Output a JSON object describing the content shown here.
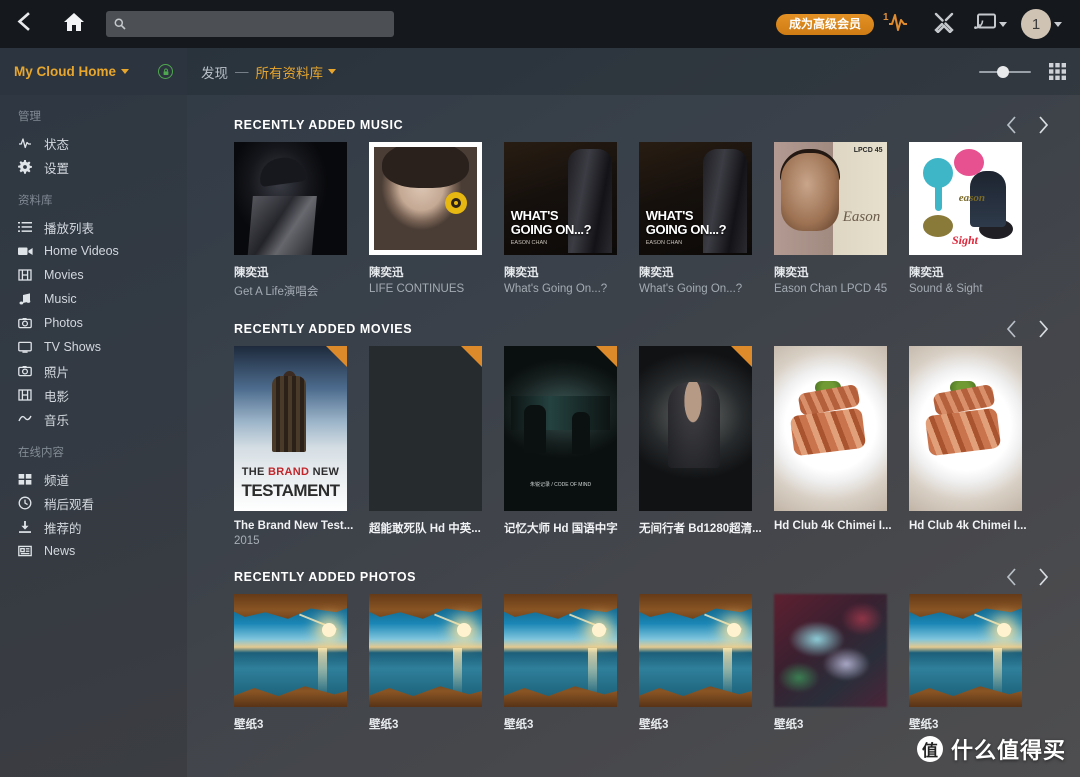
{
  "topbar": {
    "back_icon": "chevron-left-icon",
    "home_icon": "home-icon",
    "search": {
      "value": "",
      "placeholder": "",
      "icon": "search-icon"
    },
    "premium_label": "成为高级会员",
    "activity": {
      "icon": "activity-pulse-icon",
      "badge": "1"
    },
    "tools_icon": "tools-wrench-icon",
    "cast_icon": "cast-screen-icon",
    "avatar_label": "1"
  },
  "sidebar": {
    "device_name": "My Cloud Home",
    "lock_icon": "lock-secure-icon",
    "groups": [
      {
        "title": "管理",
        "items": [
          {
            "label": "状态",
            "icon": "activity-pulse-icon"
          },
          {
            "label": "设置",
            "icon": "gear-icon"
          }
        ]
      },
      {
        "title": "资料库",
        "items": [
          {
            "label": "播放列表",
            "icon": "playlist-icon"
          },
          {
            "label": "Home Videos",
            "icon": "video-camera-icon"
          },
          {
            "label": "Movies",
            "icon": "film-strip-icon"
          },
          {
            "label": "Music",
            "icon": "music-note-icon"
          },
          {
            "label": "Photos",
            "icon": "camera-icon"
          },
          {
            "label": "TV Shows",
            "icon": "tv-icon"
          },
          {
            "label": "照片",
            "icon": "camera-icon"
          },
          {
            "label": "电影",
            "icon": "film-strip-icon"
          },
          {
            "label": "音乐",
            "icon": "music-wave-icon"
          }
        ]
      },
      {
        "title": "在线内容",
        "items": [
          {
            "label": "频道",
            "icon": "grid-squares-icon"
          },
          {
            "label": "稍后观看",
            "icon": "clock-icon"
          },
          {
            "label": "推荐的",
            "icon": "download-tray-icon"
          },
          {
            "label": "News",
            "icon": "news-icon"
          }
        ]
      }
    ]
  },
  "breadcrumb": {
    "root": "发现",
    "separator": "—",
    "current": "所有资料库"
  },
  "view_controls": {
    "zoom_percent": 34,
    "grid_icon": "grid-view-icon"
  },
  "sections": [
    {
      "title": "RECENTLY ADDED MUSIC",
      "kind": "music",
      "prev_icon": "chevron-left-icon",
      "next_icon": "chevron-right-icon",
      "items": [
        {
          "title": "陳奕迅",
          "subtitle": "Get A Life演唱会",
          "art": "art-hat"
        },
        {
          "title": "陳奕迅",
          "subtitle": "LIFE CONTINUES",
          "art": "art-baby"
        },
        {
          "title": "陳奕迅",
          "subtitle": "What's Going On...?",
          "art": "art-whats"
        },
        {
          "title": "陳奕迅",
          "subtitle": "What's Going On...?",
          "art": "art-whats"
        },
        {
          "title": "陳奕迅",
          "subtitle": "Eason Chan LPCD 45",
          "art": "art-eason"
        },
        {
          "title": "陳奕迅",
          "subtitle": "Sound & Sight",
          "art": "art-sound"
        }
      ]
    },
    {
      "title": "RECENTLY ADDED MOVIES",
      "kind": "movies",
      "prev_icon": "chevron-left-icon",
      "next_icon": "chevron-right-icon",
      "items": [
        {
          "title": "The Brand New Test...",
          "year": "2015",
          "art": "p-testament",
          "flag": true
        },
        {
          "title": "超能敢死队 Hd 中英...",
          "year": "",
          "art": "p-dark",
          "flag": true
        },
        {
          "title": "记忆大师 Hd 国语中字",
          "year": "",
          "art": "p-memory",
          "flag": true
        },
        {
          "title": "无间行者 Bd1280超清...",
          "year": "",
          "art": "p-infernal",
          "flag": true
        },
        {
          "title": "Hd Club 4k Chimei I...",
          "year": "",
          "art": "p-food",
          "flag": false
        },
        {
          "title": "Hd Club 4k Chimei I...",
          "year": "",
          "art": "p-food",
          "flag": false
        }
      ]
    },
    {
      "title": "RECENTLY ADDED PHOTOS",
      "kind": "photos",
      "prev_icon": "chevron-left-icon",
      "next_icon": "chevron-right-icon",
      "items": [
        {
          "title": "壁纸3",
          "art": "ph-cave"
        },
        {
          "title": "壁纸3",
          "art": "ph-cave"
        },
        {
          "title": "壁纸3",
          "art": "ph-cave"
        },
        {
          "title": "壁纸3",
          "art": "ph-cave"
        },
        {
          "title": "壁纸3",
          "art": "ph-blur"
        },
        {
          "title": "壁纸3",
          "art": "ph-cave"
        }
      ]
    }
  ],
  "poster_texts": {
    "testament_line1_a": "THE ",
    "testament_line1_b": "BRAND",
    "testament_line1_c": " NEW",
    "testament_line2": "TESTAMENT",
    "whats_line": "WHAT'S<br>GOING ON...?",
    "whats_sub": "EASON CHAN",
    "eason_lpcd": "LPCD 45",
    "eason_sig": "Eason",
    "sound_brand": "eason",
    "sound_red": "Sight",
    "memory_cap": "朱锐记录 / CODE OF MIND"
  },
  "watermark": {
    "mark": "值",
    "text": "什么值得买"
  },
  "colors": {
    "accent_orange": "#e8a62c",
    "premium_orange": "#d9871c",
    "sidebar_bg": "#323a44",
    "topbar_bg": "#15191d",
    "main_bg": "#3a414a"
  }
}
